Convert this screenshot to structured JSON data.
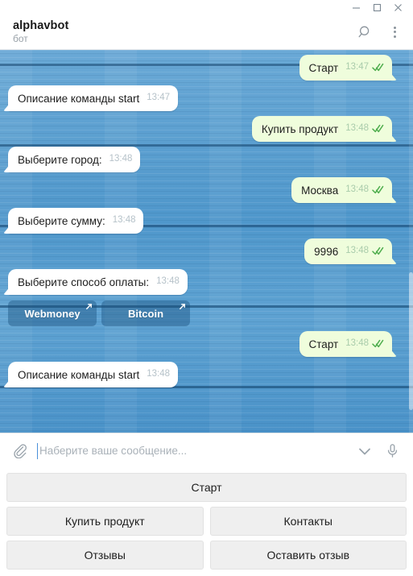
{
  "window": {
    "minimize_label": "Minimize",
    "maximize_label": "Maximize",
    "close_label": "Close"
  },
  "header": {
    "title": "alphavbot",
    "subtitle": "бот",
    "search_icon": "search-icon",
    "menu_icon": "more-vertical-icon"
  },
  "messages": [
    {
      "id": "m1",
      "direction": "out",
      "text": "Старт",
      "time": "13:47",
      "status": "read"
    },
    {
      "id": "m2",
      "direction": "in",
      "text": "Описание команды start",
      "time": "13:47"
    },
    {
      "id": "m3",
      "direction": "out",
      "text": "Купить продукт",
      "time": "13:48",
      "status": "read"
    },
    {
      "id": "m4",
      "direction": "in",
      "text": "Выберите город:",
      "time": "13:48"
    },
    {
      "id": "m5",
      "direction": "out",
      "text": "Москва",
      "time": "13:48",
      "status": "read"
    },
    {
      "id": "m6",
      "direction": "in",
      "text": "Выберите сумму:",
      "time": "13:48"
    },
    {
      "id": "m7",
      "direction": "out",
      "text": "9996",
      "time": "13:48",
      "status": "read"
    },
    {
      "id": "m8",
      "direction": "in",
      "text": "Выберите способ оплаты:",
      "time": "13:48",
      "inline_keyboard": [
        {
          "label": "Webmoney",
          "icon": "external-link-icon"
        },
        {
          "label": "Bitcoin",
          "icon": "external-link-icon"
        }
      ]
    },
    {
      "id": "m9",
      "direction": "out",
      "text": "Старт",
      "time": "13:48",
      "status": "read"
    },
    {
      "id": "m10",
      "direction": "in",
      "text": "Описание команды start",
      "time": "13:48"
    }
  ],
  "composer": {
    "attach_icon": "paperclip-icon",
    "placeholder": "Наберите ваше сообщение...",
    "value": "",
    "emoji_icon": "chevron-down-icon",
    "voice_icon": "microphone-icon"
  },
  "reply_keyboard": {
    "rows": [
      [
        "Старт"
      ],
      [
        "Купить продукт",
        "Контакты"
      ],
      [
        "Отзывы",
        "Оставить отзыв"
      ]
    ]
  },
  "colors": {
    "background": "#5a9fd0",
    "outgoing_bubble": "#effddc",
    "incoming_bubble": "#ffffff",
    "tick_green": "#4fae4e",
    "inline_button": "#174e7c",
    "keyboard_button": "#efefef"
  }
}
